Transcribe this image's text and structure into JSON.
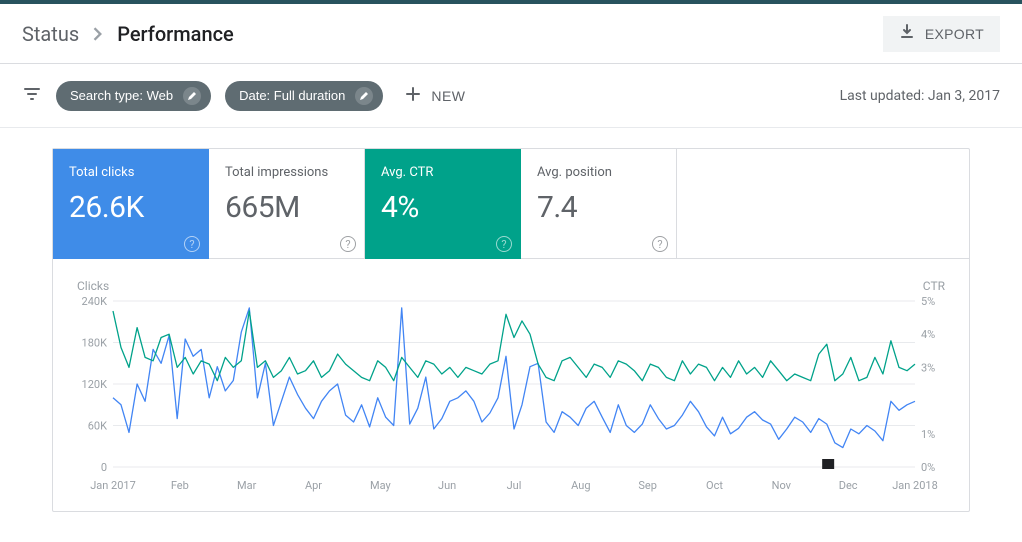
{
  "header": {
    "breadcrumb_parent": "Status",
    "breadcrumb_current": "Performance",
    "export_label": "EXPORT"
  },
  "filters": {
    "chip_search_type": "Search type: Web",
    "chip_date": "Date: Full duration",
    "new_label": "NEW",
    "last_updated": "Last updated: Jan 3, 2017"
  },
  "metrics": [
    {
      "label": "Total clicks",
      "value": "26.6K",
      "active": "blue"
    },
    {
      "label": "Total impressions",
      "value": "665M",
      "active": ""
    },
    {
      "label": "Avg. CTR",
      "value": "4%",
      "active": "teal"
    },
    {
      "label": "Avg. position",
      "value": "7.4",
      "active": ""
    }
  ],
  "chart": {
    "left_axis_label": "Clicks",
    "right_axis_label": "CTR"
  },
  "chart_data": {
    "type": "line",
    "x_categories": [
      "Jan 2017",
      "Feb",
      "Mar",
      "Apr",
      "May",
      "Jun",
      "Jul",
      "Aug",
      "Sep",
      "Oct",
      "Nov",
      "Dec",
      "Jan 2018"
    ],
    "left_axis": {
      "label": "Clicks",
      "ticks": [
        0,
        60000,
        120000,
        180000,
        240000
      ],
      "ylim": [
        0,
        240000
      ]
    },
    "right_axis": {
      "label": "CTR",
      "ticks": [
        0,
        1,
        3,
        4,
        5
      ],
      "unit": "%",
      "ylim": [
        0,
        5
      ]
    },
    "annotation": {
      "month_index": 11,
      "label": "marker-flag"
    },
    "series": [
      {
        "name": "Clicks",
        "axis": "left",
        "color": "#4285f4",
        "values": [
          100000,
          90000,
          50000,
          120000,
          95000,
          170000,
          150000,
          190000,
          70000,
          185000,
          160000,
          170000,
          100000,
          145000,
          110000,
          125000,
          195000,
          230000,
          100000,
          150000,
          60000,
          95000,
          130000,
          105000,
          85000,
          70000,
          95000,
          110000,
          120000,
          75000,
          65000,
          90000,
          58000,
          100000,
          72000,
          60000,
          230000,
          62000,
          85000,
          130000,
          55000,
          70000,
          95000,
          100000,
          110000,
          95000,
          65000,
          78000,
          100000,
          160000,
          55000,
          90000,
          145000,
          150000,
          65000,
          50000,
          80000,
          72000,
          60000,
          85000,
          95000,
          72000,
          50000,
          90000,
          60000,
          50000,
          62000,
          90000,
          70000,
          55000,
          60000,
          75000,
          95000,
          80000,
          58000,
          45000,
          72000,
          48000,
          56000,
          72000,
          80000,
          68000,
          62000,
          40000,
          55000,
          72000,
          65000,
          50000,
          70000,
          62000,
          35000,
          28000,
          55000,
          48000,
          60000,
          52000,
          38000,
          95000,
          82000,
          90000,
          95000
        ]
      },
      {
        "name": "CTR",
        "axis": "right",
        "color": "#00a28a",
        "values": [
          4.7,
          3.6,
          3.0,
          4.2,
          3.3,
          3.2,
          3.9,
          4.0,
          3.0,
          3.3,
          2.8,
          3.2,
          3.1,
          2.6,
          3.3,
          3.0,
          3.2,
          4.7,
          3.0,
          3.2,
          2.7,
          2.9,
          3.3,
          2.8,
          2.9,
          3.2,
          2.7,
          2.9,
          3.4,
          3.1,
          2.9,
          2.7,
          2.6,
          3.2,
          3.0,
          2.6,
          3.3,
          3.0,
          2.7,
          3.2,
          3.1,
          2.8,
          3.0,
          2.7,
          3.0,
          2.9,
          2.8,
          3.1,
          3.2,
          4.6,
          3.9,
          4.4,
          4.0,
          3.1,
          2.7,
          2.6,
          3.2,
          3.3,
          3.0,
          2.7,
          3.1,
          3.0,
          2.7,
          3.2,
          3.1,
          2.9,
          2.6,
          3.1,
          3.0,
          2.7,
          2.6,
          3.2,
          2.8,
          3.1,
          3.0,
          2.6,
          3.0,
          2.7,
          3.2,
          2.8,
          3.0,
          2.7,
          3.2,
          2.9,
          2.6,
          2.8,
          2.7,
          2.6,
          3.4,
          3.7,
          2.6,
          2.8,
          3.3,
          2.6,
          2.7,
          3.3,
          2.8,
          3.8,
          3.0,
          2.9,
          3.1
        ]
      }
    ]
  }
}
